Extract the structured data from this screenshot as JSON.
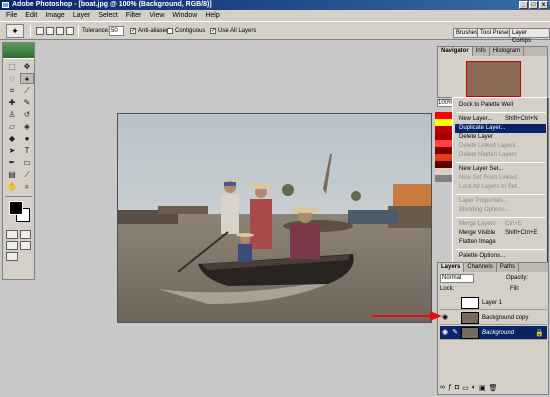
{
  "window": {
    "title": "Adobe Photoshop - [boat.jpg @ 100% (Background, RGB/8)]",
    "min": "_",
    "max": "□",
    "close": "x"
  },
  "menu": [
    "File",
    "Edit",
    "Image",
    "Layer",
    "Select",
    "Filter",
    "View",
    "Window",
    "Help"
  ],
  "options": {
    "tolerance_label": "Tolerance:",
    "tolerance_value": "50",
    "anti_aliased": "Anti-aliased",
    "contiguous": "Contiguous",
    "use_all_layers": "Use All Layers",
    "check_mark": "✓"
  },
  "palette_well": [
    "Brushes",
    "Tool Presets",
    "Layer Comps"
  ],
  "navigator": {
    "tabs": [
      "Navigator",
      "Info",
      "Histogram"
    ],
    "zoom": "100%"
  },
  "context_menu": {
    "items": [
      {
        "label": "Dock to Palette Well",
        "shortcut": "",
        "state": "normal"
      },
      {
        "label": "New Layer...",
        "shortcut": "Shift+Ctrl+N",
        "state": "normal"
      },
      {
        "label": "Duplicate Layer...",
        "shortcut": "",
        "state": "highlighted"
      },
      {
        "label": "Delete Layer",
        "shortcut": "",
        "state": "normal"
      },
      {
        "label": "Delete Linked Layers",
        "shortcut": "",
        "state": "disabled"
      },
      {
        "label": "Delete Hidden Layers",
        "shortcut": "",
        "state": "disabled"
      },
      {
        "label": "New Layer Set...",
        "shortcut": "",
        "state": "normal"
      },
      {
        "label": "New Set From Linked...",
        "shortcut": "",
        "state": "disabled"
      },
      {
        "label": "Lock All Layers In Set...",
        "shortcut": "",
        "state": "disabled"
      },
      {
        "label": "Layer Properties...",
        "shortcut": "",
        "state": "disabled"
      },
      {
        "label": "Blending Options...",
        "shortcut": "",
        "state": "disabled"
      },
      {
        "label": "Merge Layers",
        "shortcut": "Ctrl+E",
        "state": "disabled"
      },
      {
        "label": "Merge Visible",
        "shortcut": "Shift+Ctrl+E",
        "state": "normal"
      },
      {
        "label": "Flatten Image",
        "shortcut": "",
        "state": "normal"
      },
      {
        "label": "Palette Options...",
        "shortcut": "",
        "state": "normal"
      }
    ]
  },
  "layers_panel": {
    "tabs": [
      "Layers",
      "Channels",
      "Paths"
    ],
    "blend_mode": "Normal",
    "opacity_label": "Opacity:",
    "fill_label": "Fill:",
    "lock_label": "Lock:",
    "layers": [
      {
        "name": "Layer 1",
        "visible": false,
        "selected": false
      },
      {
        "name": "Background copy",
        "visible": true,
        "selected": false
      },
      {
        "name": "Background",
        "visible": true,
        "selected": true
      }
    ]
  },
  "colors": {
    "accent": "#0a246a",
    "arrow": "#e01010",
    "nav_frame": "#cc0000"
  }
}
